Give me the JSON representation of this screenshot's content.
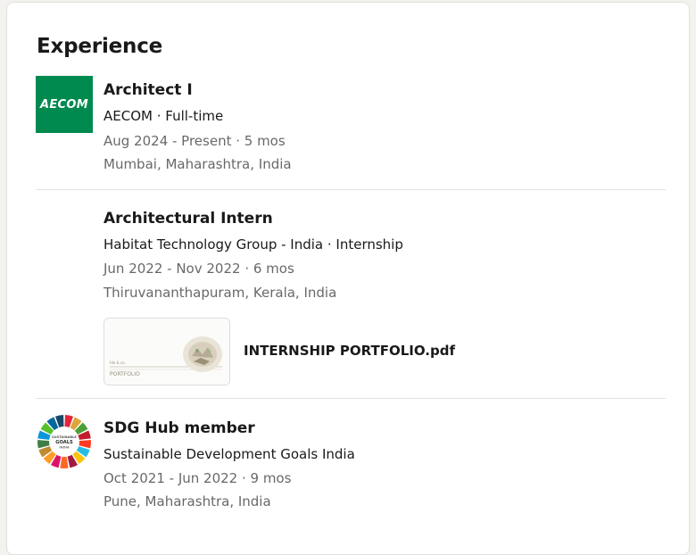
{
  "section": {
    "title": "Experience"
  },
  "experience": [
    {
      "title": "Architect I",
      "company": "AECOM · Full-time",
      "dates": "Aug 2024 - Present · 5 mos",
      "location": "Mumbai, Maharashtra, India",
      "logo_text": "AECOM"
    },
    {
      "title": "Architectural Intern",
      "company": "Habitat Technology Group - India · Internship",
      "dates": "Jun 2022 - Nov 2022 · 6 mos",
      "location": "Thiruvananthapuram, Kerala, India",
      "media": {
        "label": "INTERNSHIP PORTFOLIO.pdf",
        "thumb_caption": "PORTFOLIO"
      }
    },
    {
      "title": "SDG Hub member",
      "company": "Sustainable Development Goals India",
      "dates": "Oct 2021 - Jun 2022 · 9 mos",
      "location": "Pune, Maharashtra, India",
      "logo_text": [
        "SUSTAINABLE",
        "GOALS",
        "INDIA"
      ]
    }
  ],
  "colors": {
    "aecom_green": "#008a4f",
    "sdg_wheel": [
      "#e5243b",
      "#dda63a",
      "#4c9f38",
      "#c5192d",
      "#ff3a21",
      "#26bde2",
      "#fcc30b",
      "#a21942",
      "#fd6925",
      "#dd1367",
      "#fd9d24",
      "#bf8b2e",
      "#3f7e44",
      "#0a97d9",
      "#56c02b",
      "#00689d",
      "#19486a"
    ]
  }
}
